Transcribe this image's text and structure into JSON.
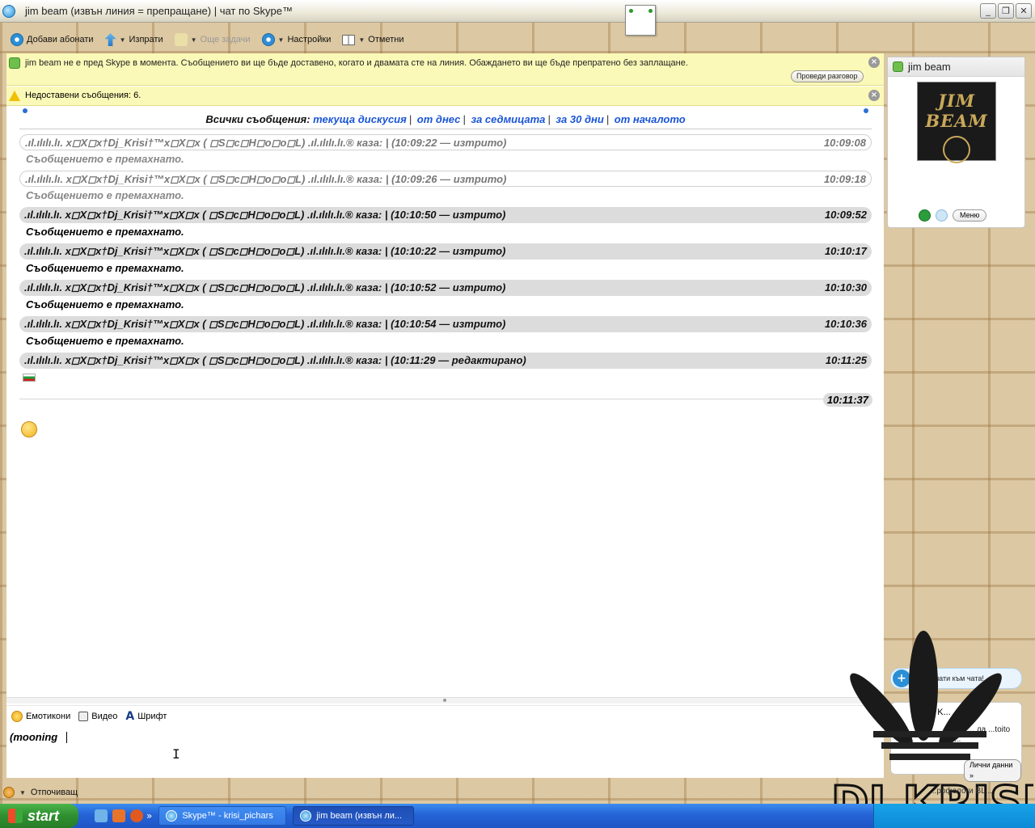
{
  "window": {
    "title": "jim beam (извън линия = препращане)  |  чат по Skype™"
  },
  "toolbar": {
    "add": "Добави абонати",
    "send": "Изпрати",
    "more": "Още задачи",
    "settings": "Настройки",
    "mark": "Отметни"
  },
  "notice": {
    "text": "jim beam не е пред Skype в момента. Съобщението ви ще бъде доставено, когато и двамата сте на линия. Обаждането ви ще бъде препратено без заплащане.",
    "button": "Проведи разговор"
  },
  "undelivered": {
    "text": "Недоставени съобщения: 6."
  },
  "filter": {
    "label": "Всички съобщения:",
    "current": "текуща дискусия",
    "today": "от днес",
    "week": "за седмицата",
    "days30": "за 30 дни",
    "all": "от началото"
  },
  "messages": [
    {
      "head": ".ıl.ılılı.lı.  x◻X◻x†Dj_Krisi†™x◻X◻x  ( ◻S◻c◻H◻o◻o◻L) .ıl.ılılı.lı.® каза:  | (10:09:22 — изтрито)",
      "time": "10:09:08",
      "body": "Съобщението е премахнато."
    },
    {
      "head": ".ıl.ılılı.lı.  x◻X◻x†Dj_Krisi†™x◻X◻x  ( ◻S◻c◻H◻o◻o◻L) .ıl.ılılı.lı.® каза:  | (10:09:26 — изтрито)",
      "time": "10:09:18",
      "body": "Съобщението е премахнато."
    },
    {
      "head": ".ıl.ılılı.lı.  x◻X◻x†Dj_Krisi†™x◻X◻x  ( ◻S◻c◻H◻o◻o◻L) .ıl.ılılı.lı.® каза:  | (10:10:50 — изтрито)",
      "time": "10:09:52",
      "body": "Съобщението е премахнато."
    },
    {
      "head": ".ıl.ılılı.lı.  x◻X◻x†Dj_Krisi†™x◻X◻x  ( ◻S◻c◻H◻o◻o◻L) .ıl.ılılı.lı.® каза:  | (10:10:22 — изтрито)",
      "time": "10:10:17",
      "body": "Съобщението е премахнато."
    },
    {
      "head": ".ıl.ılılı.lı.  x◻X◻x†Dj_Krisi†™x◻X◻x  ( ◻S◻c◻H◻o◻o◻L) .ıl.ılılı.lı.® каза:  | (10:10:52 — изтрито)",
      "time": "10:10:30",
      "body": "Съобщението е премахнато."
    },
    {
      "head": ".ıl.ılılı.lı.  x◻X◻x†Dj_Krisi†™x◻X◻x  ( ◻S◻c◻H◻o◻o◻L) .ıl.ılılı.lı.® каза:  | (10:10:54 — изтрито)",
      "time": "10:10:36",
      "body": "Съобщението е премахнато."
    },
    {
      "head": ".ıl.ılılı.lı.  x◻X◻x†Dj_Krisi†™x◻X◻x  ( ◻S◻c◻H◻o◻o◻L) .ıl.ılılı.lı.® каза:  | (10:11:29 — редактирано)",
      "time": "10:11:25",
      "body": ""
    }
  ],
  "last_time": "10:11:37",
  "compose_bar": {
    "emoticons": "Емотикони",
    "video": "Видео",
    "font": "Шрифт"
  },
  "compose": {
    "text": "(mooning"
  },
  "status": {
    "label": "Отпочиващ"
  },
  "profile": {
    "name": "jim beam",
    "avatar_text": "JIM BEAM",
    "menu": "Меню"
  },
  "side": {
    "add_note": "...и абонати към чата!",
    "card_title": "I...                K...",
    "card_body": "...и ... да ...toito ...",
    "card_button": "Лични данни »"
  },
  "tray": {
    "text": "...рофологи BL..."
  },
  "taskbar": {
    "start": "start",
    "task1": "Skype™ - krisi_pichars",
    "task2": "jim beam (извън ли..."
  },
  "watermark": {
    "text": "DJ.KRISI"
  },
  "colors": {
    "notice_bg": "#fbf9b7",
    "link": "#1a55d6",
    "taskbar": "#2463d6",
    "start": "#3a9a3a"
  }
}
